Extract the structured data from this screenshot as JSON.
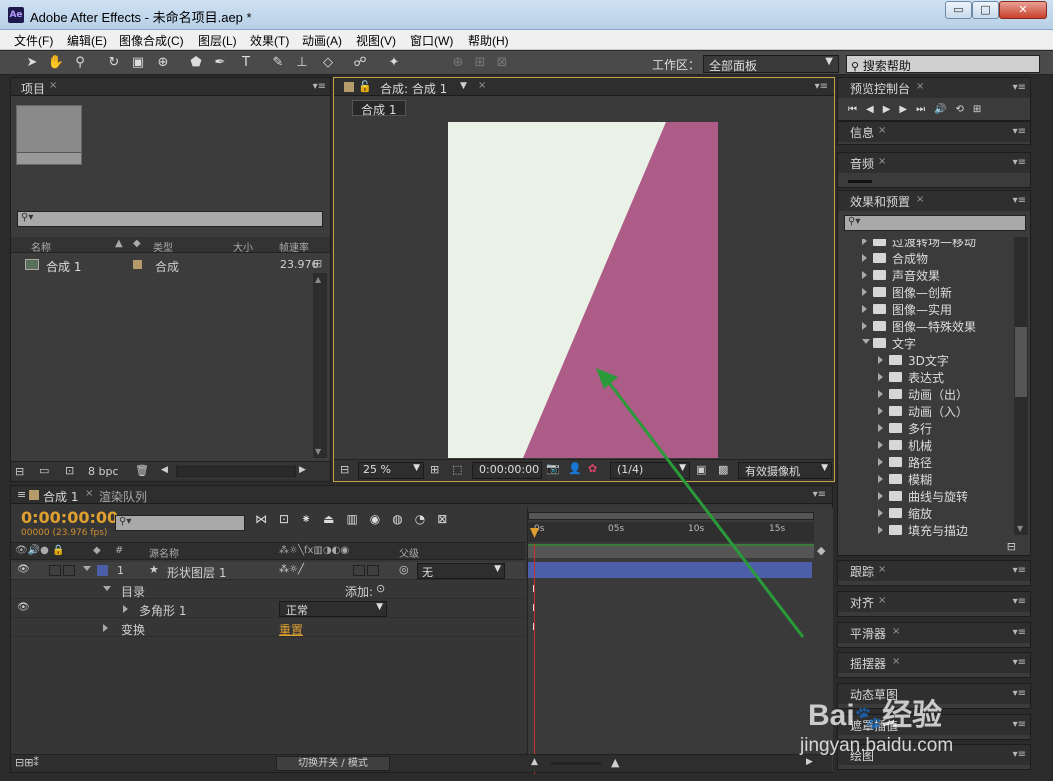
{
  "window": {
    "title": "Adobe After Effects - 未命名项目.aep *",
    "app_icon": "Ae",
    "minimize": "▭",
    "maximize": "□",
    "close": "✕"
  },
  "menu": [
    "文件(F)",
    "编辑(E)",
    "图像合成(C)",
    "图层(L)",
    "效果(T)",
    "动画(A)",
    "视图(V)",
    "窗口(W)",
    "帮助(H)"
  ],
  "toolbar": {
    "workspace_label": "工作区：",
    "workspace_value": "全部面板",
    "search_placeholder": "搜索帮助",
    "tool_icons": [
      "selection-tool-icon",
      "hand-tool-icon",
      "zoom-tool-icon",
      "rotate-tool-icon",
      "camera-tool-icon",
      "pan-behind-tool-icon",
      "shape-tool-icon",
      "pen-tool-icon",
      "type-tool-icon",
      "brush-tool-icon",
      "clone-stamp-tool-icon",
      "eraser-tool-icon",
      "roto-brush-tool-icon",
      "puppet-tool-icon"
    ]
  },
  "project": {
    "tab": "项目",
    "columns": {
      "name": "名称",
      "type": "类型",
      "size": "大小",
      "framerate": "帧速率"
    },
    "items": [
      {
        "name": "合成 1",
        "type": "合成",
        "fps": "23.976"
      }
    ],
    "bpc": "8 bpc"
  },
  "composition": {
    "tab": "合成: 合成 1",
    "breadcrumb": "合成 1",
    "zoom": "25 %",
    "timecode": "0:00:00:00",
    "resolution": "(1/4)",
    "camera": "有效摄像机",
    "colors": {
      "background": "#eaf2e8",
      "shape": "#ad5b87"
    }
  },
  "right_panels": {
    "preview": "预览控制台",
    "info": "信息",
    "audio": "音频",
    "effects": "效果和预置",
    "effects_tree": [
      {
        "label": "过渡转场—移动",
        "level": 0,
        "expanded": false
      },
      {
        "label": "合成物",
        "level": 0,
        "expanded": false
      },
      {
        "label": "声音效果",
        "level": 0,
        "expanded": false
      },
      {
        "label": "图像—创新",
        "level": 0,
        "expanded": false
      },
      {
        "label": "图像—实用",
        "level": 0,
        "expanded": false
      },
      {
        "label": "图像—特殊效果",
        "level": 0,
        "expanded": false
      },
      {
        "label": "文字",
        "level": 0,
        "expanded": true
      },
      {
        "label": "3D文字",
        "level": 1,
        "expanded": false
      },
      {
        "label": "表达式",
        "level": 1,
        "expanded": false
      },
      {
        "label": "动画（出）",
        "level": 1,
        "expanded": false
      },
      {
        "label": "动画（入）",
        "level": 1,
        "expanded": false
      },
      {
        "label": "多行",
        "level": 1,
        "expanded": false
      },
      {
        "label": "机械",
        "level": 1,
        "expanded": false
      },
      {
        "label": "路径",
        "level": 1,
        "expanded": false
      },
      {
        "label": "模糊",
        "level": 1,
        "expanded": false
      },
      {
        "label": "曲线与旋转",
        "level": 1,
        "expanded": false
      },
      {
        "label": "缩放",
        "level": 1,
        "expanded": false
      },
      {
        "label": "填充与描边",
        "level": 1,
        "expanded": false
      }
    ],
    "tracker": "跟踪",
    "align": "对齐",
    "smoother": "平滑器",
    "wiggler": "摇摆器",
    "motion_sketch": "动态草图",
    "mask_interp": "遮罩插值",
    "paint": "绘图"
  },
  "timeline": {
    "tab_comp": "合成 1",
    "tab_render": "渲染队列",
    "timecode": "0:00:00:00",
    "frame_info": "00000 (23.976 fps)",
    "col_source": "源名称",
    "col_parent": "父级",
    "ruler": [
      "0s",
      "05s",
      "10s",
      "15s"
    ],
    "layer": {
      "num": "1",
      "name": "形状图层 1",
      "parent": "无"
    },
    "contents": "目录",
    "add": "添加:",
    "polygon": "多角形 1",
    "blend": "正常",
    "transform": "变换",
    "reset": "重置",
    "toggle": "切换开关 / 模式",
    "colors": {
      "timecode": "#e0a030",
      "layer_bar": "#4d5ea8",
      "playhead": "#c8312b"
    }
  },
  "watermark": {
    "brand": "Bai",
    "brand2": "经验",
    "url": "jingyan.baidu.com"
  },
  "annotation": {
    "arrow_color": "#2a9a3a"
  }
}
